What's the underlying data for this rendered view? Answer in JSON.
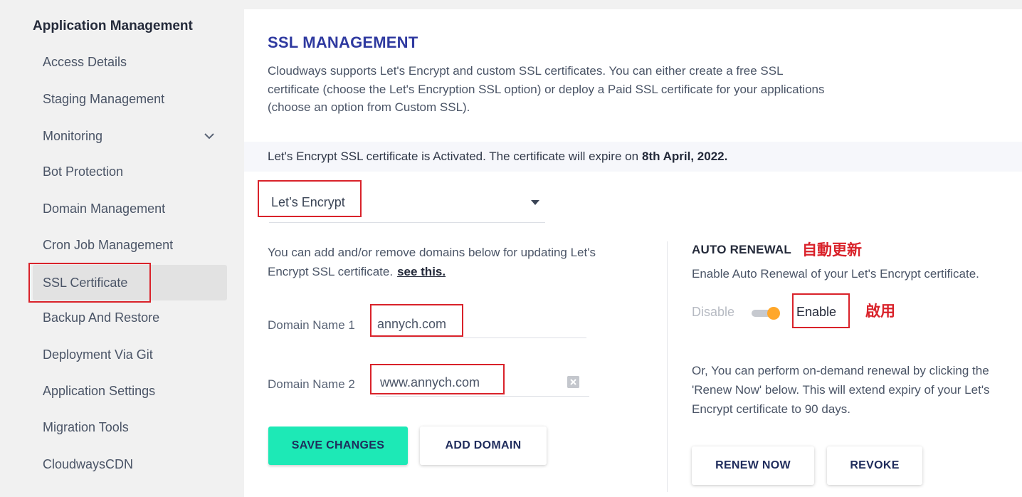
{
  "sidebar": {
    "title": "Application Management",
    "items": [
      {
        "label": "Access Details"
      },
      {
        "label": "Staging Management"
      },
      {
        "label": "Monitoring"
      },
      {
        "label": "Bot Protection"
      },
      {
        "label": "Domain Management"
      },
      {
        "label": "Cron Job Management"
      },
      {
        "label": "SSL Certificate",
        "active": true
      },
      {
        "label": "Backup And Restore"
      },
      {
        "label": "Deployment Via Git"
      },
      {
        "label": "Application Settings"
      },
      {
        "label": "Migration Tools"
      },
      {
        "label": "CloudwaysCDN"
      }
    ]
  },
  "main": {
    "title": "SSL MANAGEMENT",
    "description": "Cloudways supports Let's Encrypt and custom SSL certificates. You can either create a free SSL certificate (choose the Let's Encryption SSL option) or deploy a Paid SSL certificate for your applications (choose an option from Custom SSL).",
    "status_text": "Let's Encrypt SSL certificate is Activated. The certificate will expire on",
    "status_date": "8th April, 2022.",
    "ssl_type_selected": "Let’s Encrypt",
    "domains_info": "You can add and/or remove domains below for updating Let's Encrypt SSL certificate.",
    "see_this_link": "see this.",
    "domain1_label": "Domain Name 1",
    "domain1_value": "annych.com",
    "domain2_label": "Domain Name 2",
    "domain2_value": "www.annych.com",
    "save_button": "SAVE CHANGES",
    "add_domain_button": "ADD DOMAIN"
  },
  "auto_renewal": {
    "title": "AUTO RENEWAL",
    "title_annotation": "自動更新",
    "description": "Enable Auto Renewal of your Let's Encrypt certificate.",
    "off_label": "Disable",
    "on_label": "Enable",
    "on_annotation": "啟用",
    "enabled": true,
    "manual_text": "Or, You can perform on-demand renewal by clicking the 'Renew Now' below. This will extend expiry of your Let's Encrypt certificate to 90 days.",
    "renew_button": "RENEW NOW",
    "revoke_button": "REVOKE"
  },
  "colors": {
    "accent_title": "#2f3aa0",
    "primary_button": "#1de9b6",
    "toggle_knob": "#ffa72a",
    "annotation": "#d9222a"
  }
}
